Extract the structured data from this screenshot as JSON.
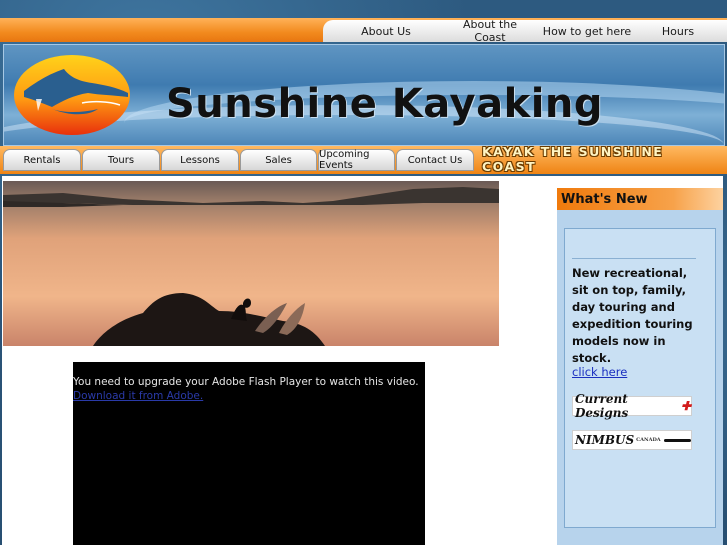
{
  "top_nav": [
    "About Us",
    "About the Coast",
    "How to get here",
    "Hours"
  ],
  "brand": {
    "name": "Sunshine Kayaking"
  },
  "tabs": [
    "Rentals",
    "Tours",
    "Lessons",
    "Sales",
    "Upcoming Events",
    "Contact Us"
  ],
  "tagline": "KAYAK THE SUNSHINE COAST",
  "video": {
    "message": "You need to upgrade your Adobe Flash Player to watch this video.",
    "download_link": "Download it from Adobe."
  },
  "sidebar": {
    "heading": "What's New",
    "text": "New recreational, sit on top, family, day touring and expedition touring models now in stock.",
    "link": "click here",
    "logos": [
      {
        "name": "Current Designs",
        "sub": ""
      },
      {
        "name": "NIMBUS",
        "sub": "CANADA"
      }
    ]
  },
  "colors": {
    "orange": "#f28a1e",
    "banner_blue": "#3f7bb0",
    "sidebar_blue": "#b7d3ec",
    "link_blue": "#1a2fc0"
  }
}
